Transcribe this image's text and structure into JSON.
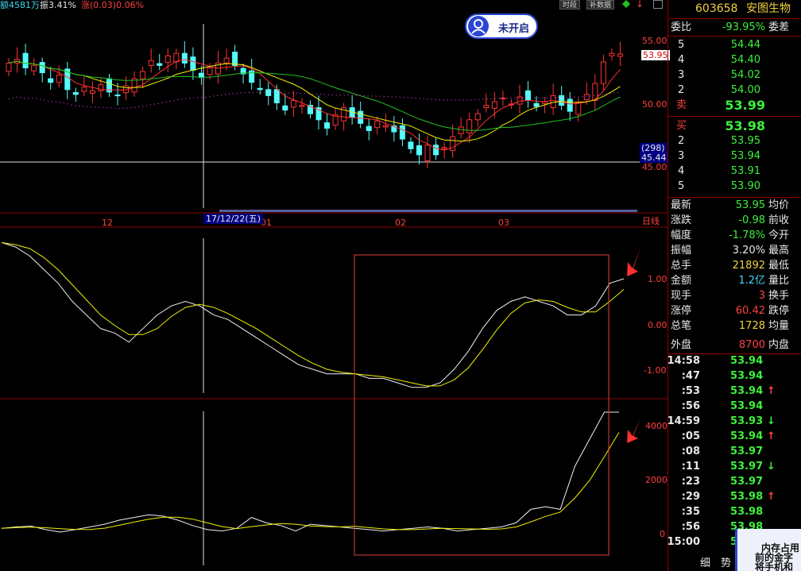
{
  "top_info": {
    "amount": "额4581万",
    "amplitude": "振3.41%",
    "change": "涨(0.03)0.06%"
  },
  "toolbar": {
    "period_btn": "时段",
    "supplement_btn": "补数据",
    "indicator_arrow": "↓"
  },
  "user_widget": {
    "label": "未开启"
  },
  "main_chart": {
    "price_labels": [
      "55.00",
      "50.00",
      "45.00"
    ],
    "current_price": "53.95",
    "low_count": "(298)",
    "low_price": "45.44",
    "date_labels": [
      "12",
      "01",
      "02",
      "03"
    ],
    "cursor_date": "17/12/22(五)",
    "period": "日线"
  },
  "panel2": {
    "axis_labels": [
      "1.00",
      "0.00",
      "-1.00"
    ]
  },
  "panel3": {
    "axis_labels": [
      "4000",
      "2000",
      "0"
    ]
  },
  "stock": {
    "code": "603658",
    "name": "安图生物"
  },
  "order_book": {
    "ratio_label": "委比",
    "ratio_value": "-93.95%",
    "diff_label": "委差",
    "sell_label": "卖",
    "buy_label": "买",
    "sells": [
      {
        "level": "5",
        "price": "54.44"
      },
      {
        "level": "4",
        "price": "54.40"
      },
      {
        "level": "3",
        "price": "54.02"
      },
      {
        "level": "2",
        "price": "54.00"
      },
      {
        "level": "",
        "price": "53.99"
      }
    ],
    "buys": [
      {
        "level": "",
        "price": "53.98"
      },
      {
        "level": "2",
        "price": "53.95"
      },
      {
        "level": "3",
        "price": "53.94"
      },
      {
        "level": "4",
        "price": "53.91"
      },
      {
        "level": "5",
        "price": "53.90"
      }
    ]
  },
  "quote": [
    {
      "label": "最新",
      "value": "53.95",
      "color": "green",
      "label2": "均价"
    },
    {
      "label": "涨跌",
      "value": "-0.98",
      "color": "green",
      "label2": "前收"
    },
    {
      "label": "幅度",
      "value": "-1.78%",
      "color": "green",
      "label2": "今开"
    },
    {
      "label": "振幅",
      "value": "3.20%",
      "color": "white",
      "label2": "最高"
    },
    {
      "label": "总手",
      "value": "21892",
      "color": "yellow",
      "label2": "最低"
    },
    {
      "label": "金额",
      "value": "1.2亿",
      "color": "cyan",
      "label2": "量比"
    },
    {
      "label": "现手",
      "value": "3",
      "color": "red",
      "label2": "换手"
    },
    {
      "label": "涨停",
      "value": "60.42",
      "color": "red",
      "label2": "跌停"
    },
    {
      "label": "总笔",
      "value": "1728",
      "color": "yellow",
      "label2": "均量"
    },
    {
      "label": "外盘",
      "value": "8700",
      "color": "red",
      "label2": "内盘"
    }
  ],
  "ticks": [
    {
      "time": "14:58",
      "price": "53.94",
      "arrow": ""
    },
    {
      "time": ":47",
      "price": "53.94",
      "arrow": ""
    },
    {
      "time": ":53",
      "price": "53.94",
      "arrow": "↑"
    },
    {
      "time": ":56",
      "price": "53.94",
      "arrow": ""
    },
    {
      "time": "14:59",
      "price": "53.93",
      "arrow": "↓"
    },
    {
      "time": ":05",
      "price": "53.94",
      "arrow": "↑"
    },
    {
      "time": ":08",
      "price": "53.97",
      "arrow": ""
    },
    {
      "time": ":11",
      "price": "53.97",
      "arrow": "↓"
    },
    {
      "time": ":23",
      "price": "53.97",
      "arrow": ""
    },
    {
      "time": ":29",
      "price": "53.98",
      "arrow": "↑"
    },
    {
      "time": ":35",
      "price": "53.98",
      "arrow": ""
    },
    {
      "time": ":56",
      "price": "53.98",
      "arrow": ""
    },
    {
      "time": "15:00",
      "price": "53.98",
      "arrow": ""
    }
  ],
  "bottom_tabs": {
    "tab1": "细",
    "tab2": "势"
  },
  "popup": {
    "line1": "内存占用",
    "line2": "前的金字",
    "line3": "将手机和"
  },
  "colors": {
    "up": "#ff3232",
    "down": "#54fcfc",
    "ma5": "#f0f0f0",
    "ma10": "#f0f000",
    "ma20": "#ff3232",
    "ma30": "#22c022",
    "bg": "#000000"
  }
}
